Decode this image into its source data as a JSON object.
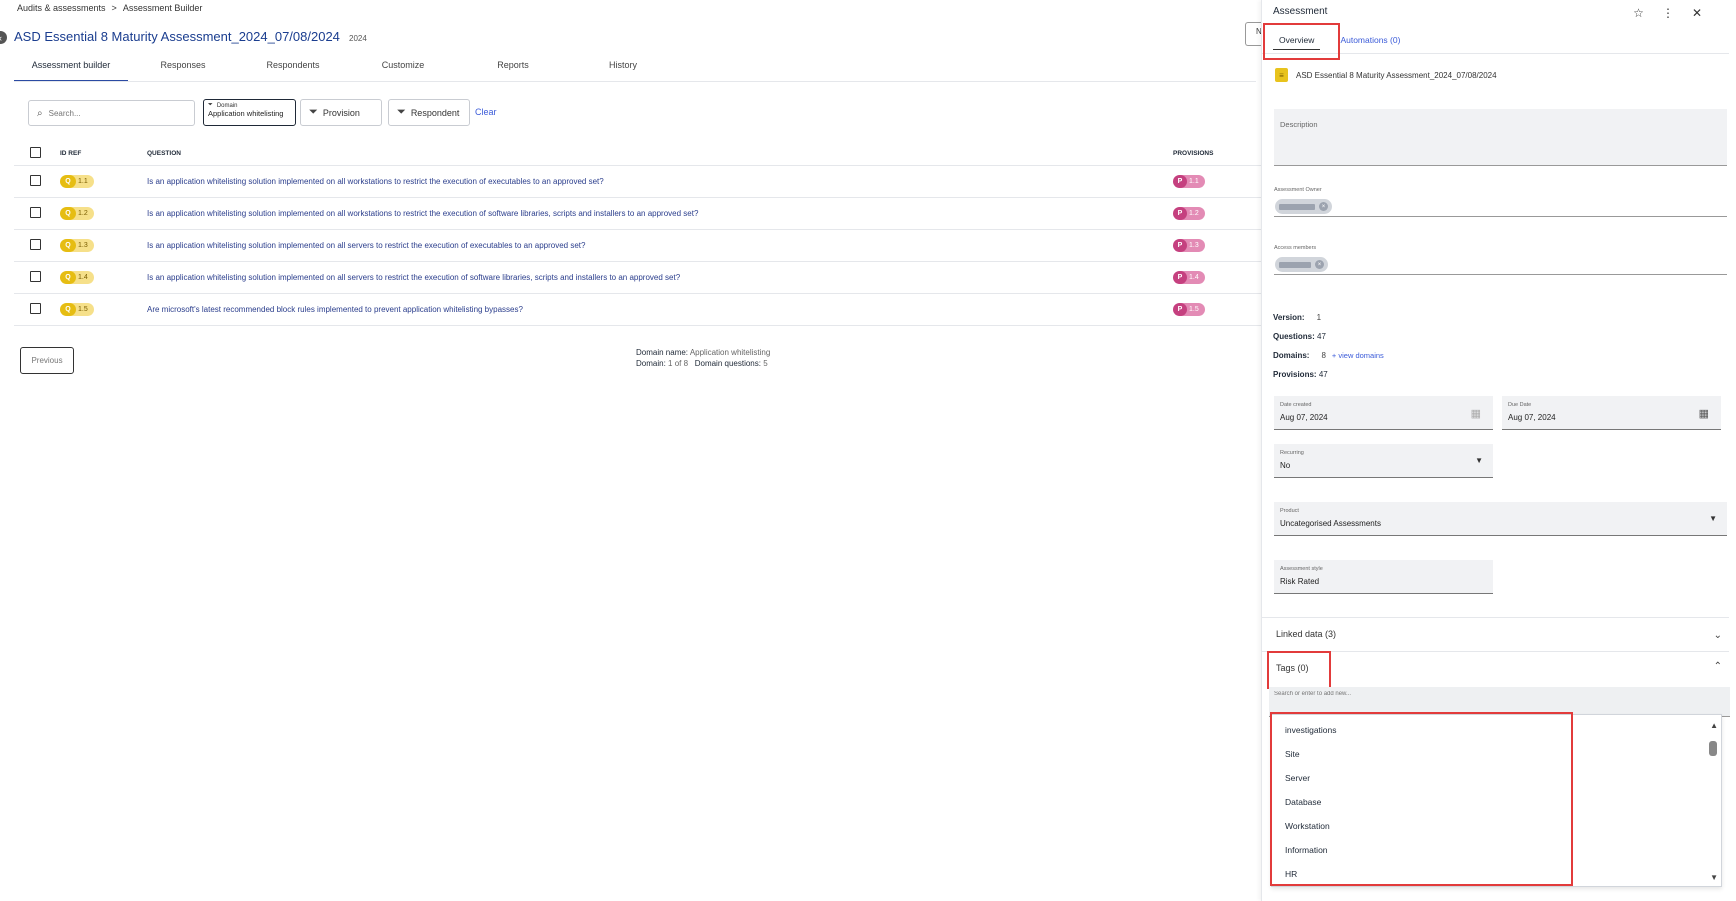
{
  "breadcrumb": {
    "parent": "Audits & assessments",
    "separator": ">",
    "current": "Assessment Builder"
  },
  "back_icon": "chevron-left-icon",
  "title": "ASD Essential 8 Maturity Assessment_2024_07/08/2024",
  "title_year": "2024",
  "top_right_button_label": "N",
  "tabs": [
    {
      "label": "Assessment builder"
    },
    {
      "label": "Responses"
    },
    {
      "label": "Respondents"
    },
    {
      "label": "Customize"
    },
    {
      "label": "Reports"
    },
    {
      "label": "History"
    }
  ],
  "filters": {
    "search_placeholder": "Search...",
    "domain_label": "Domain",
    "domain_value": "Application whitelisting",
    "provision_label": "Provision",
    "respondent_label": "Respondent",
    "clear_label": "Clear"
  },
  "table": {
    "headers": {
      "id": "ID REF",
      "question": "QUESTION",
      "provisions": "PROVISIONS"
    },
    "rows": [
      {
        "q": "Q",
        "id": "1.1",
        "question": "Is an application whitelisting solution implemented on all workstations to restrict the execution of executables to an approved set?",
        "p": "P",
        "prov": "1.1"
      },
      {
        "q": "Q",
        "id": "1.2",
        "question": "Is an application whitelisting solution implemented on all workstations to restrict the execution of software libraries, scripts and installers to an approved set?",
        "p": "P",
        "prov": "1.2"
      },
      {
        "q": "Q",
        "id": "1.3",
        "question": "Is an application whitelisting solution implemented on all servers to restrict the execution of executables to an approved set?",
        "p": "P",
        "prov": "1.3"
      },
      {
        "q": "Q",
        "id": "1.4",
        "question": "Is an application whitelisting solution implemented on all servers to restrict the execution of software libraries, scripts and installers to an approved set?",
        "p": "P",
        "prov": "1.4"
      },
      {
        "q": "Q",
        "id": "1.5",
        "question": "Are microsoft's latest recommended block rules implemented to prevent application whitelisting bypasses?",
        "p": "P",
        "prov": "1.5"
      }
    ]
  },
  "pagination": {
    "previous_label": "Previous",
    "domain_name_label": "Domain name:",
    "domain_name_value": "Application whitelisting",
    "domain_label": "Domain:",
    "domain_value": "1 of 8",
    "domain_questions_label": "Domain questions:",
    "domain_questions_value": "5"
  },
  "panel": {
    "title": "Assessment",
    "icons": [
      "star-icon",
      "more-vert-icon",
      "close-icon"
    ],
    "tabs": {
      "overview": "Overview",
      "automations": "Automations (0)"
    },
    "assessment_name": "ASD Essential 8 Maturity Assessment_2024_07/08/2024",
    "description_label": "Description",
    "owner_label": "Assessment Owner",
    "access_label": "Access members",
    "stats": {
      "version_label": "Version:",
      "version": "1",
      "questions_label": "Questions:",
      "questions": "47",
      "domains_label": "Domains:",
      "domains": "8",
      "view_domains": "+ view domains",
      "provisions_label": "Provisions:",
      "provisions": "47"
    },
    "date_created_label": "Date created",
    "date_created": "Aug 07, 2024",
    "due_date_label": "Due Date",
    "due_date": "Aug 07, 2024",
    "recurring_label": "Recurring",
    "recurring": "No",
    "product_label": "Product",
    "product": "Uncategorised Assessments",
    "style_label": "Assessment style",
    "style": "Risk Rated",
    "linked_data": "Linked data (3)",
    "tags": "Tags (0)",
    "tag_search_placeholder": "Search or enter to add new...",
    "tag_options": [
      "investigations",
      "Site",
      "Server",
      "Database",
      "Workstation",
      "Information",
      "HR"
    ]
  },
  "colors": {
    "accent": "#2b4aa3",
    "link": "#3b5bd9",
    "highlight": "#e23b3b",
    "question_badge": "#e6bd12",
    "provision_badge": "#c5407f"
  }
}
